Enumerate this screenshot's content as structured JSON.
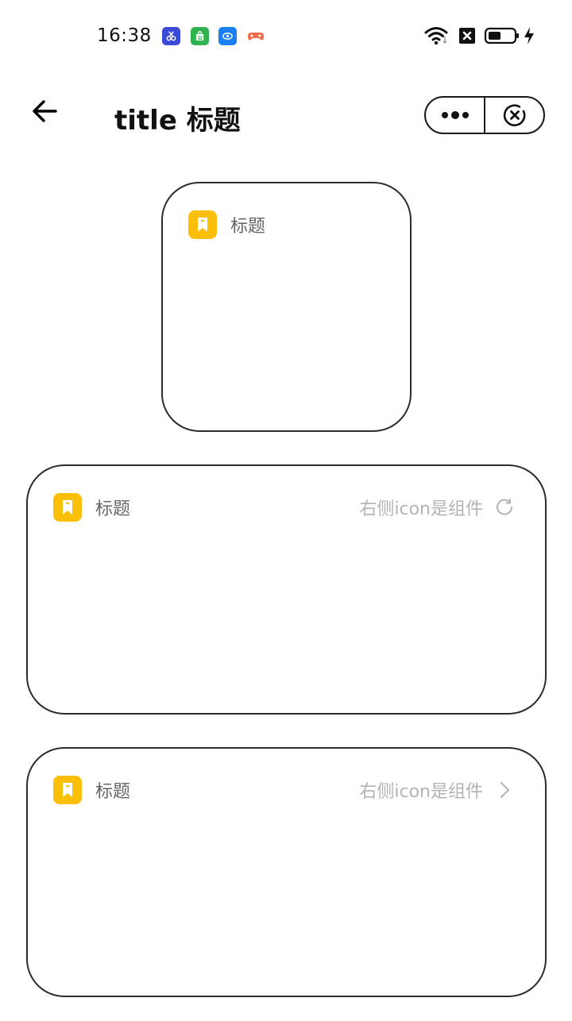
{
  "status_bar": {
    "time": "16:38",
    "apps": [
      "scissors-app-icon",
      "store-app-icon",
      "eye-app-icon",
      "game-app-icon"
    ]
  },
  "nav": {
    "title": "title 标题"
  },
  "cards": [
    {
      "title": "标题"
    },
    {
      "title": "标题",
      "right_text": "右侧icon是组件",
      "right_icon": "refresh-icon"
    },
    {
      "title": "标题",
      "right_text": "右侧icon是组件",
      "right_icon": "chevron-right-icon"
    }
  ],
  "colors": {
    "badge": "#fbbf08",
    "title_text": "#666666",
    "right_text": "#b3b3b3",
    "border": "#2c2c2c"
  }
}
